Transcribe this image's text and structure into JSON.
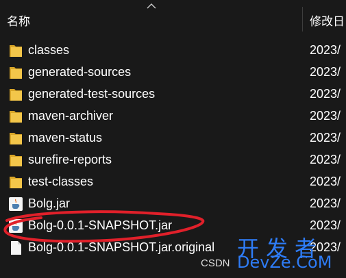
{
  "header": {
    "name_col": "名称",
    "date_col": "修改日"
  },
  "rows": [
    {
      "name": "classes",
      "date": "2023/",
      "icon": "folder-icon"
    },
    {
      "name": "generated-sources",
      "date": "2023/",
      "icon": "folder-icon"
    },
    {
      "name": "generated-test-sources",
      "date": "2023/",
      "icon": "folder-icon"
    },
    {
      "name": "maven-archiver",
      "date": "2023/",
      "icon": "folder-icon"
    },
    {
      "name": "maven-status",
      "date": "2023/",
      "icon": "folder-icon"
    },
    {
      "name": "surefire-reports",
      "date": "2023/",
      "icon": "folder-icon"
    },
    {
      "name": "test-classes",
      "date": "2023/",
      "icon": "folder-icon"
    },
    {
      "name": "Bolg.jar",
      "date": "2023/",
      "icon": "java-jar-icon"
    },
    {
      "name": "Bolg-0.0.1-SNAPSHOT.jar",
      "date": "2023/",
      "icon": "java-jar-icon"
    },
    {
      "name": "Bolg-0.0.1-SNAPSHOT.jar.original",
      "date": "2023/",
      "icon": "file-icon"
    }
  ],
  "watermark": {
    "big": "开发者",
    "csdn": "CSDN",
    "url": "DevZe.CoM"
  },
  "colors": {
    "background": "#191919",
    "folder": "#f0c23c",
    "annotation": "#e0202a",
    "watermark": "#2e7cf6"
  }
}
